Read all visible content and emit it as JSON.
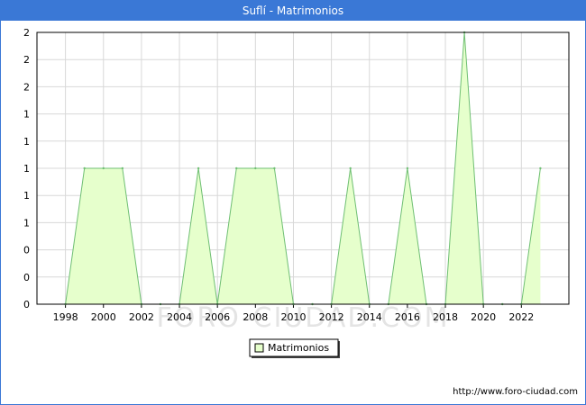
{
  "window": {
    "title": "Suflí - Matrimonios"
  },
  "footer": {
    "source": "http://www.foro-ciudad.com"
  },
  "watermark": {
    "text": "FORO-CIUDAD.COM"
  },
  "colors": {
    "titlebar": "#3a78d6",
    "fill": "#e6ffcc",
    "line": "#6fbf73",
    "grid": "#d8d8d8"
  },
  "chart_data": {
    "type": "area",
    "title": "Suflí - Matrimonios",
    "xlabel": "",
    "ylabel": "",
    "x": [
      1998,
      1999,
      2000,
      2001,
      2002,
      2003,
      2004,
      2005,
      2006,
      2007,
      2008,
      2009,
      2010,
      2011,
      2012,
      2013,
      2014,
      2015,
      2016,
      2017,
      2018,
      2019,
      2020,
      2021,
      2022,
      2023
    ],
    "series": [
      {
        "name": "Matrimonios",
        "values": [
          0,
          1,
          1,
          1,
          0,
          0,
          0,
          1,
          0,
          1,
          1,
          1,
          0,
          0,
          0,
          1,
          0,
          0,
          1,
          0,
          0,
          2,
          0,
          0,
          0,
          1
        ]
      }
    ],
    "xticks": [
      "1998",
      "2000",
      "2002",
      "2004",
      "2006",
      "2008",
      "2010",
      "2012",
      "2014",
      "2016",
      "2018",
      "2020",
      "2022"
    ],
    "yticks": [
      "0",
      "0",
      "0",
      "1",
      "1",
      "1",
      "1",
      "1",
      "2",
      "2",
      "2"
    ],
    "ylim": [
      0,
      2
    ],
    "grid": true,
    "legend_position": "bottom-center"
  }
}
